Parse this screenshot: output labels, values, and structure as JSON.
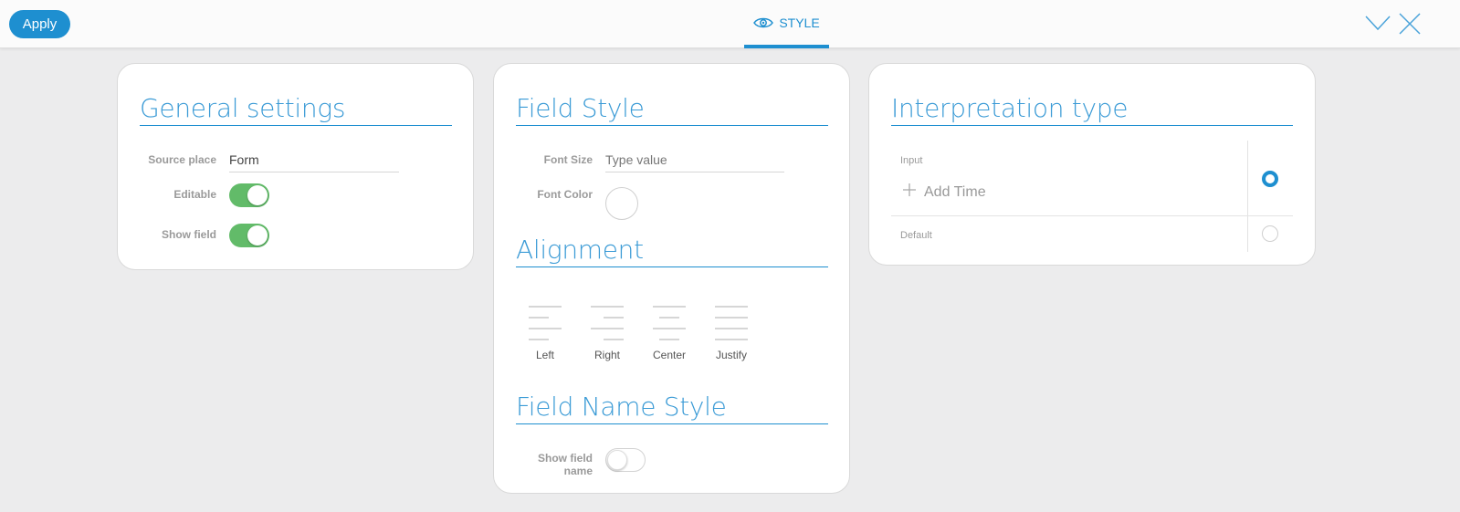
{
  "toolbar": {
    "apply_label": "Apply",
    "style_tab_label": "STYLE",
    "style_tab_icon": "eye-icon",
    "collapse_icon": "chevron-down-icon",
    "close_icon": "close-icon",
    "accent_color": "#1e8fd0"
  },
  "general": {
    "title": "General settings",
    "source_place_label": "Source place",
    "source_place_value": "Form",
    "editable_label": "Editable",
    "editable_on": true,
    "show_field_label": "Show field",
    "show_field_on": true
  },
  "field_style": {
    "title": "Field Style",
    "font_size_label": "Font Size",
    "font_size_placeholder": "Type value",
    "font_color_label": "Font Color",
    "alignment_title": "Alignment",
    "alignment_options": [
      {
        "label": "Left",
        "icon": "align-left-icon"
      },
      {
        "label": "Right",
        "icon": "align-right-icon"
      },
      {
        "label": "Center",
        "icon": "align-center-icon"
      },
      {
        "label": "Justify",
        "icon": "align-justify-icon"
      }
    ],
    "field_name_title": "Field Name Style",
    "show_field_name_label_1": "Show field",
    "show_field_name_label_2": "name",
    "show_field_name_on": false
  },
  "interpretation": {
    "title": "Interpretation type",
    "options": [
      {
        "label": "Input",
        "action": "Add Time",
        "selected": true
      },
      {
        "label": "Default",
        "selected": false
      }
    ]
  }
}
